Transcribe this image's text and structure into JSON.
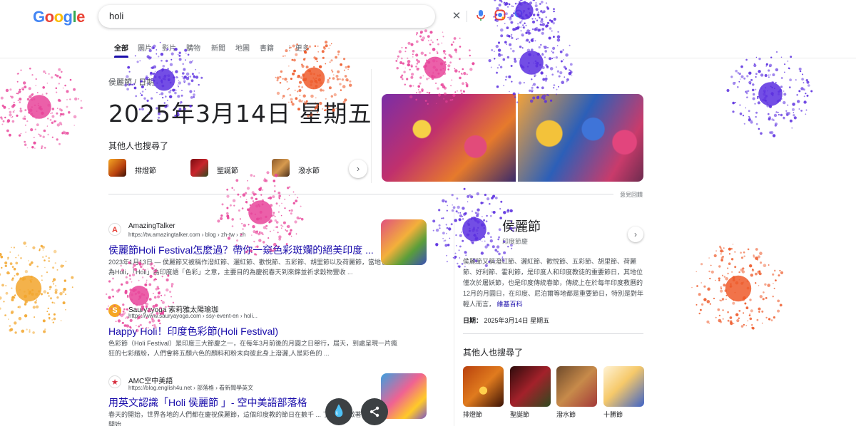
{
  "search": {
    "query": "holi"
  },
  "tabs": [
    "全部",
    "圖片",
    "影片",
    "購物",
    "新聞",
    "地圖",
    "書籍",
    "⋮ 更多"
  ],
  "date_card": {
    "breadcrumb": "侯麗節 / 日期",
    "big_date": "2025年3月14日 星期五",
    "also_searched_title": "其他人也搜尋了",
    "chips": [
      "排燈節",
      "聖誕節",
      "潑水節"
    ],
    "feedback": "意見回饋"
  },
  "results": [
    {
      "favicon": "A",
      "site": "AmazingTalker",
      "url": "https://tw.amazingtalker.com › blog › zh-tw › zh",
      "title": "侯麗節Holi Festival怎麼過？帶你一窺色彩斑斕的絕美印度 ...",
      "snippet": "2023年1月13日 — 侯麗節又被稱作潑紅節、灑紅節、歡悅節、五彩節、胡里節以及荷麗節，當地也稱其為Holi，「Holi」為印度語「色彩」之意，主要目的為慶祝春天到來錦並祈求穀物豐收 ..."
    },
    {
      "favicon": "S",
      "site": "Sauryayoga 索莉雅太陽瑜珈",
      "url": "https://www.sauryayoga.com › ssy-event-en › holi...",
      "title": "Happy Holi！印度色彩節(Holi Festival)",
      "snippet": "色彩節（Holi Festival）是印度三大節慶之一，在每年3月前後的月圓之日舉行，屆天，到處呈現一片瘋狂的七彩繽紛，人們會將五顏六色的顏料和粉末向彼此身上潑灑,人是彩色的 ..."
    },
    {
      "favicon": "★",
      "site": "AMC空中美語",
      "url": "https://blog.english4u.net › 部落格 › 看新聞學英文",
      "title": "用英文認識「Holi 侯麗節 」- 空中美語部落格",
      "snippet": "春天的開始，世界各地的人們都在慶祝侯麗節，這個印度教的節日在數千 ... 了，它象徵著春天和希望的開始 ..."
    }
  ],
  "knowledge_panel": {
    "title": "侯麗節",
    "subtitle": "印度節慶",
    "description": "侯麗節又稱潑紅節、灑紅節、歡悅節、五彩節、胡里節、荷麗節、好利節、霍利節，是印度人和印度教徒的重要節日，其地位僅次於屠妖節，也是印度傳統春節，傳統上在於每年印度教曆的12月的月圓日，在印度、尼泊爾等地都是重要節日，特別是對年輕人而言，",
    "wiki_link": "維基百科",
    "date_label": "日期：",
    "date_value": "2025年3月14日 星期五",
    "also_title": "其他人也搜尋了",
    "cards": [
      "排燈節",
      "聖誕節",
      "潑水節",
      "十勝節"
    ]
  },
  "fireworks_colors": [
    "#e8449a",
    "#5b2fe0",
    "#ee5a2a",
    "#f2a52b"
  ]
}
